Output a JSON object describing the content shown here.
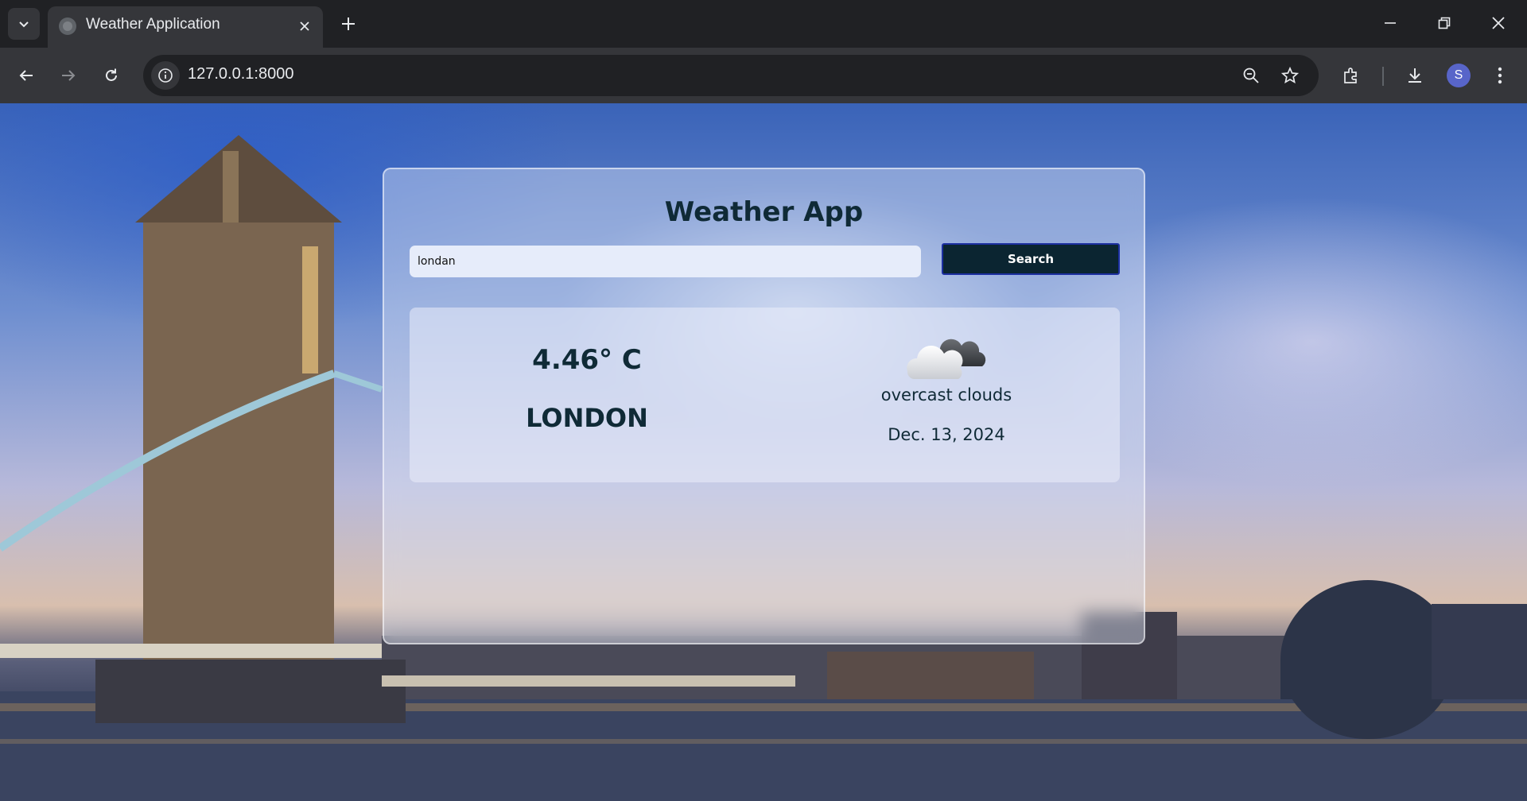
{
  "browser": {
    "tab_title": "Weather Application",
    "url": "127.0.0.1:8000",
    "profile_initial": "S"
  },
  "page": {
    "title": "Weather App",
    "search": {
      "value": "londan",
      "button_label": "Search"
    },
    "weather": {
      "temperature": "4.46° C",
      "city": "LONDON",
      "icon": "overcast-clouds-icon",
      "condition": "overcast clouds",
      "date": "Dec. 13, 2024"
    }
  },
  "colors": {
    "text_dark": "#0f2a36",
    "button_bg": "#0b2531",
    "button_border": "#1c2fa0",
    "chrome_bg": "#202124",
    "toolbar_bg": "#35363a"
  }
}
